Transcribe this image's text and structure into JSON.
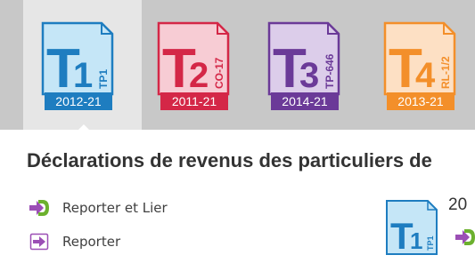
{
  "forms": [
    {
      "form": "T1",
      "code": "TP1",
      "year": "2012-21",
      "color": "#1e7dc0",
      "light": "#c5e6f7",
      "selected": true
    },
    {
      "form": "T2",
      "code": "CO-17",
      "year": "2011-21",
      "color": "#d42747",
      "light": "#f7ccd4",
      "selected": false
    },
    {
      "form": "T3",
      "code": "TP-646",
      "year": "2014-21",
      "color": "#6b3a98",
      "light": "#dccdea",
      "selected": false
    },
    {
      "form": "T4",
      "code": "RL-1/2",
      "year": "2013-21",
      "color": "#f38f2a",
      "light": "#fde0c4",
      "selected": false
    }
  ],
  "section": {
    "title": "Déclarations de revenus des particuliers de"
  },
  "actions": [
    {
      "label": "Reporter et Lier",
      "icon": "carry-forward-link-icon"
    },
    {
      "label": "Reporter",
      "icon": "carry-forward-icon"
    }
  ],
  "side_panel": {
    "form": "T1",
    "code": "TP1",
    "year_partial": "20",
    "icon": "carry-forward-link-icon"
  }
}
